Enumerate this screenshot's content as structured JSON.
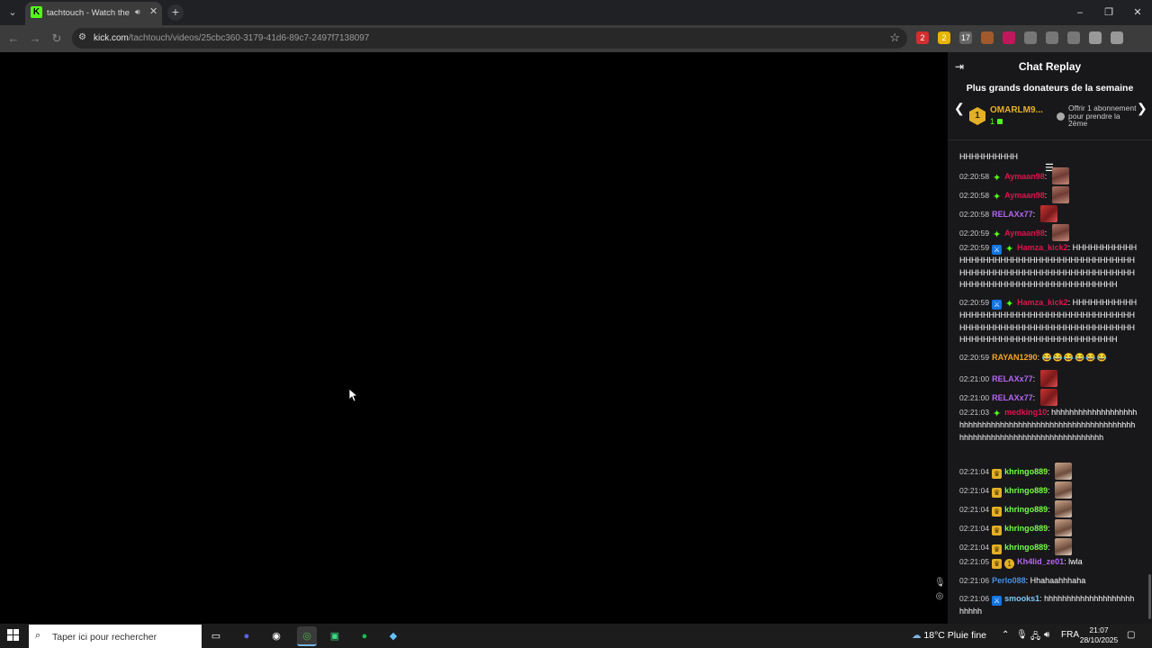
{
  "browser": {
    "tab_title": "tachtouch - Watch the VOD",
    "tab_favicon": "K",
    "url_host": "kick.com",
    "url_path": "/tachtouch/videos/25cbc360-3179-41d6-89c7-2497f7138097",
    "icons": {
      "tab_menu": "chevron-down-icon",
      "audio": "speaker-icon",
      "close": "close-icon",
      "new_tab": "plus-icon",
      "back": "arrow-left-icon",
      "forward": "arrow-right-icon",
      "reload": "reload-icon",
      "site_info": "site-info-icon",
      "bookmark": "star-icon"
    },
    "window_controls": [
      "–",
      "❐",
      "✕"
    ],
    "extensions": [
      {
        "name": "ublock-icon",
        "color": "#d32f2f",
        "badge": "2"
      },
      {
        "name": "coupon-icon",
        "color": "#e8b400",
        "badge": "2"
      },
      {
        "name": "calendar-icon",
        "color": "#666666",
        "badge": "17"
      },
      {
        "name": "cookie-icon",
        "color": "#a05a2c",
        "badge": ""
      },
      {
        "name": "ext-u-icon",
        "color": "#c2185b",
        "badge": ""
      },
      {
        "name": "puzzle-icon",
        "color": "#777777",
        "badge": ""
      },
      {
        "name": "history-icon",
        "color": "#777777",
        "badge": ""
      },
      {
        "name": "media-icon",
        "color": "#777777",
        "badge": ""
      },
      {
        "name": "profile-icon",
        "color": "#999999",
        "badge": ""
      },
      {
        "name": "menu-icon",
        "color": "#999999",
        "badge": ""
      }
    ]
  },
  "chat": {
    "title": "Chat Replay",
    "donors_title": "Plus grands donateurs de la semaine",
    "top_donor": {
      "rank": "1",
      "name": "OMARLM9...",
      "count": "1"
    },
    "gift_text": "Offrir 1 abonnement pour prendre la 2ème",
    "messages": [
      {
        "ts": "",
        "user": "",
        "color": "",
        "badges": [],
        "text": "HHHHHHHHHH",
        "emote": ""
      },
      {
        "ts": "02:20:58",
        "user": "Aymaan98",
        "color": "#e0144c",
        "badges": [
          "green"
        ],
        "text": "",
        "emote": "face"
      },
      {
        "ts": "02:20:58",
        "user": "Aymaan98",
        "color": "#e0144c",
        "badges": [
          "green"
        ],
        "text": "",
        "emote": "face"
      },
      {
        "ts": "02:20:58",
        "user": "RELAXx77",
        "color": "#b565f5",
        "badges": [],
        "text": "",
        "emote": "red"
      },
      {
        "ts": "02:20:59",
        "user": "Aymaan98",
        "color": "#e0144c",
        "badges": [
          "green"
        ],
        "text": "",
        "emote": "face"
      },
      {
        "ts": "02:20:59",
        "user": "Hamza_kick2",
        "color": "#e0144c",
        "badges": [
          "blue",
          "green"
        ],
        "text": "HHHHHHHHHHHHHHHHHHHHHHHHHHHHHHHHHHHHHHHHHHHHHHHHHHHHHHHHHHHHHHHHHHHHHHHHHHHHHHHHHHHHHHHHHHHHHHHHHH",
        "emote": ""
      },
      {
        "ts": "02:20:59",
        "user": "Hamza_kick2",
        "color": "#e0144c",
        "badges": [
          "blue",
          "green"
        ],
        "text": "HHHHHHHHHHHHHHHHHHHHHHHHHHHHHHHHHHHHHHHHHHHHHHHHHHHHHHHHHHHHHHHHHHHHHHHHHHHHHHHHHHHHHHHHHHHHHHHHHH",
        "emote": ""
      },
      {
        "ts": "02:20:59",
        "user": "RAYAN1290",
        "color": "#f5a623",
        "badges": [],
        "text": "😂😂😂😂😂😂",
        "emote": ""
      },
      {
        "ts": "02:21:00",
        "user": "RELAXx77",
        "color": "#b565f5",
        "badges": [],
        "text": "",
        "emote": "red"
      },
      {
        "ts": "02:21:00",
        "user": "RELAXx77",
        "color": "#b565f5",
        "badges": [],
        "text": "",
        "emote": "red"
      },
      {
        "ts": "02:21:03",
        "user": "medking10",
        "color": "#e0144c",
        "badges": [
          "green"
        ],
        "text": "hhhhhhhhhhhhhhhhhhhhhhhhhhhhhhhhhhhhhhhhhhhhhhhhhhhhhhhhhhhhhhhhhhhhhhhhhhhhhhhhhhhhhhhhhh",
        "emote": ""
      },
      {
        "ts": "02:21:04",
        "user": "khringo889",
        "color": "#75fd46",
        "badges": [
          "crown"
        ],
        "text": "",
        "emote": "man"
      },
      {
        "ts": "02:21:04",
        "user": "khringo889",
        "color": "#75fd46",
        "badges": [
          "crown"
        ],
        "text": "",
        "emote": "man"
      },
      {
        "ts": "02:21:04",
        "user": "khringo889",
        "color": "#75fd46",
        "badges": [
          "crown"
        ],
        "text": "",
        "emote": "man"
      },
      {
        "ts": "02:21:04",
        "user": "khringo889",
        "color": "#75fd46",
        "badges": [
          "crown"
        ],
        "text": "",
        "emote": "man"
      },
      {
        "ts": "02:21:04",
        "user": "khringo889",
        "color": "#75fd46",
        "badges": [
          "crown"
        ],
        "text": "",
        "emote": "man"
      },
      {
        "ts": "02:21:05",
        "user": "Kh4lid_ze01",
        "color": "#b565f5",
        "badges": [
          "crown",
          "one"
        ],
        "text": "lwla",
        "emote": ""
      },
      {
        "ts": "02:21:06",
        "user": "Perlo088",
        "color": "#4a90e2",
        "badges": [],
        "text": "Hhahaahhhaha",
        "emote": ""
      },
      {
        "ts": "02:21:06",
        "user": "smooks1",
        "color": "#7ec8f7",
        "badges": [
          "blue"
        ],
        "text": "hhhhhhhhhhhhhhhhhhhhhhhhh",
        "emote": ""
      }
    ]
  },
  "taskbar": {
    "search_placeholder": "Taper ici pour rechercher",
    "apps": [
      {
        "name": "task-view-icon",
        "color": "#ffffff",
        "glyph": "▭"
      },
      {
        "name": "discord-icon",
        "color": "#5865f2",
        "glyph": "●"
      },
      {
        "name": "obs-icon",
        "color": "#ffffff",
        "glyph": "◉"
      },
      {
        "name": "chrome-icon",
        "color": "#4caf50",
        "glyph": "◎"
      },
      {
        "name": "chat-app-icon",
        "color": "#3ddc84",
        "glyph": "▣"
      },
      {
        "name": "spotify-icon",
        "color": "#1db954",
        "glyph": "●"
      },
      {
        "name": "steam-icon",
        "color": "#66c0f4",
        "glyph": "◆"
      }
    ],
    "weather": "18°C  Pluie fine",
    "language": "FRA",
    "time": "21:07",
    "date": "28/10/2025"
  }
}
